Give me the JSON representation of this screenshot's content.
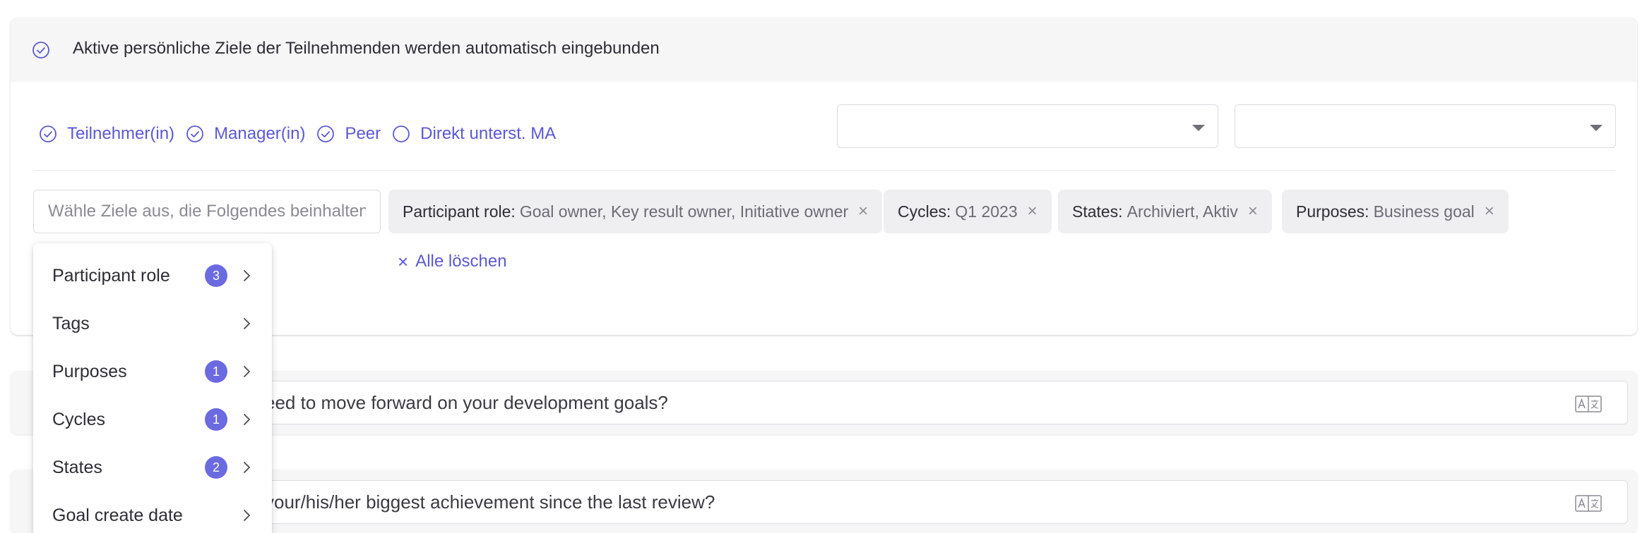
{
  "header": {
    "text": "Aktive persönliche Ziele der Teilnehmenden werden automatisch eingebunden"
  },
  "roles": [
    {
      "label": "Teilnehmer(in)",
      "checked": true
    },
    {
      "label": "Manager(in)",
      "checked": true
    },
    {
      "label": "Peer",
      "checked": true
    },
    {
      "label": "Direkt unterst. MA",
      "checked": false
    }
  ],
  "filter": {
    "search_placeholder": "Wähle Ziele aus, die Folgendes beinhalten",
    "chips": [
      {
        "key": "Participant role:",
        "value": "Goal owner, Key result owner, Initiative owner"
      },
      {
        "key": "Cycles:",
        "value": "Q1 2023"
      },
      {
        "key": "States:",
        "value": "Archiviert, Aktiv"
      },
      {
        "key": "Purposes:",
        "value": "Business goal"
      }
    ],
    "clear_all": "Alle löschen",
    "remove_glyph": "×"
  },
  "questions": [
    {
      "text": "eed to move forward on your development goals?"
    },
    {
      "text": "your/his/her biggest achievement since the last review?"
    }
  ],
  "dropdown": {
    "items": [
      {
        "label": "Participant role",
        "badge": "3"
      },
      {
        "label": "Tags",
        "badge": ""
      },
      {
        "label": "Purposes",
        "badge": "1"
      },
      {
        "label": "Cycles",
        "badge": "1"
      },
      {
        "label": "States",
        "badge": "2"
      },
      {
        "label": "Goal create date",
        "badge": ""
      }
    ]
  },
  "colors": {
    "accent": "#5b58d6",
    "badge": "#6c6ae0",
    "header_bg": "#f6f6f7",
    "chip_bg": "#efeff2"
  },
  "icons": {
    "header": "check-circle-icon",
    "role_checked": "check-circle-icon",
    "role_unchecked": "empty-circle-icon",
    "chip_remove": "close-icon",
    "dropdown_arrow": "chevron-right-icon",
    "translate": "translate-icon"
  }
}
